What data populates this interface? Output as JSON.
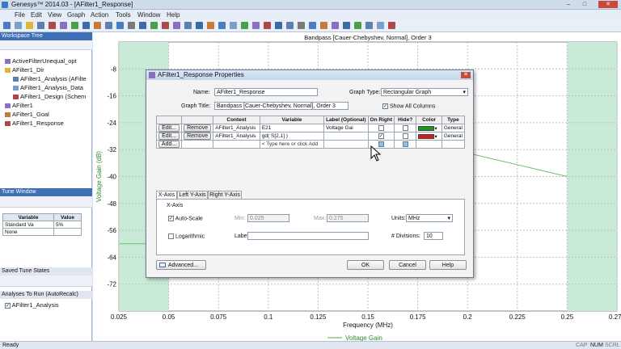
{
  "window": {
    "title": "Genesys™ 2014.03 - [AFilter1_Response]",
    "minimize": "–",
    "maximize": "□",
    "close": "✕"
  },
  "menu": [
    "File",
    "Edit",
    "View",
    "Graph",
    "Action",
    "Tools",
    "Window",
    "Help"
  ],
  "workspace": {
    "header": "Workspace Tree",
    "items": [
      "ActiveFilterUnequal_opt",
      "AFilter1_Dir",
      "AFilter1_Analysis (AFilte",
      "AFilter1_Analysis_Data",
      "AFilter1_Design (Schem",
      "AFilter1",
      "AFilter1_Goal",
      "AFilter1_Response"
    ]
  },
  "tune": {
    "header": "Tune Window",
    "cols": [
      "Variable",
      "Value"
    ],
    "rows": [
      [
        "Standard Va",
        "5%"
      ],
      [
        "None",
        ""
      ]
    ]
  },
  "saved_tune": {
    "header": "Saved Tune States"
  },
  "analyses": {
    "header": "Analyses To Run (AutoRecalc)",
    "item": "AFilter1_Analysis"
  },
  "status": {
    "left": "Ready",
    "cap": "CAP",
    "num": "NUM",
    "scrl": "SCRL"
  },
  "chart_data": {
    "type": "line",
    "title": "Bandpass [Cauer-Chebyshev, Normal], Order 3",
    "xlabel": "Frequency (MHz)",
    "ylabel": "Voltage Gain (dB)",
    "xlim": [
      0.025,
      0.275
    ],
    "ylim": [
      -80,
      0
    ],
    "xticks": [
      "0.025",
      "0.05",
      "0.075",
      "0.1",
      "0.125",
      "0.15",
      "0.175",
      "0.2",
      "0.225",
      "0.25",
      "0.275"
    ],
    "yticks": [
      "-8",
      "-16",
      "-24",
      "-32",
      "-40",
      "-48",
      "-56",
      "-64",
      "-72"
    ],
    "legend": "Voltage Gain",
    "legend_position": "bottom",
    "grid": true,
    "series": [
      {
        "name": "Voltage Gain",
        "color": "#6fbf6f",
        "x": [
          0.025,
          0.05,
          0.055,
          0.06,
          0.2,
          0.25
        ],
        "y": [
          -60,
          -60,
          -70,
          -60,
          -33,
          -40
        ]
      }
    ],
    "shaded_regions": [
      [
        0.025,
        0.05
      ],
      [
        0.25,
        0.275
      ]
    ]
  },
  "dialog": {
    "title": "AFilter1_Response Properties",
    "name_label": "Name:",
    "name": "AFilter1_Response",
    "graph_type_label": "Graph Type:",
    "graph_type": "Rectangular Graph",
    "graph_title_label": "Graph Title:",
    "graph_title": "Bandpass [Cauer-Chebyshev, Normal], Order 3",
    "show_all_columns": "Show All Columns",
    "cols": [
      "",
      "",
      "Context",
      "Variable",
      "Label (Optional)",
      "On Right",
      "Hide?",
      "Color",
      "Type"
    ],
    "rows": [
      {
        "edit": "Edit...",
        "remove": "Remove",
        "context": "AFilter1_Analysis",
        "variable": "E21",
        "label": "Voltage Gai",
        "on_right": false,
        "hide": false,
        "color": "#1a9a1a",
        "type": "General"
      },
      {
        "edit": "Edit...",
        "remove": "Remove",
        "context": "AFilter1_Analysis",
        "variable": "gd( S[2,1] )",
        "label": "",
        "on_right": true,
        "hide": false,
        "color": "#d81818",
        "type": "General"
      }
    ],
    "add": "Add...",
    "add_placeholder": "< Type here or click Add",
    "tabs": [
      "X-Axis",
      "Left Y-Axis",
      "Right Y-Axis"
    ],
    "xaxis_group": "X-Axis",
    "auto_scale": "Auto-Scale",
    "min_label": "Min:",
    "min": "0.025",
    "max_label": "Max:",
    "max": "0.275",
    "units_label": "Units:",
    "units": "MHz",
    "logarithmic": "Logarithmic",
    "label_label": "Label:",
    "label_value": "",
    "divisions_label": "# Divisions:",
    "divisions": "10",
    "advanced": "Advanced...",
    "ok": "OK",
    "cancel": "Cancel",
    "help": "Help"
  }
}
